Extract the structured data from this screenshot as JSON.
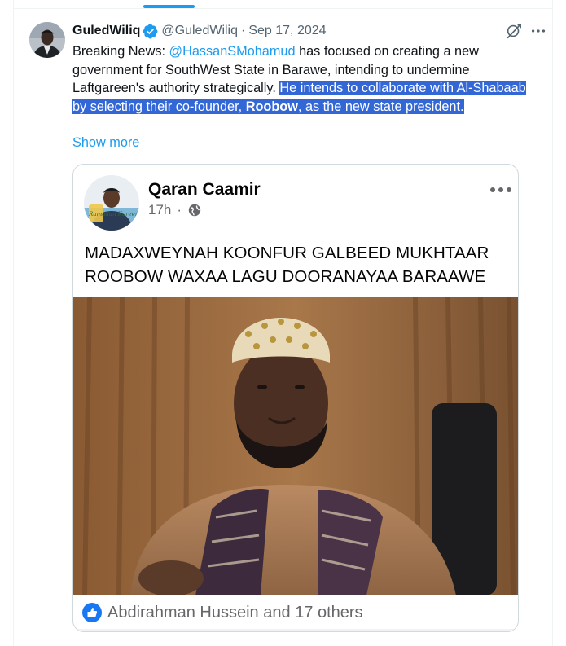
{
  "tweet": {
    "author_name": "GuledWiliq",
    "author_handle": "@GuledWiliq",
    "separator": "·",
    "date": "Sep 17, 2024",
    "text_before_mention": "Breaking News: ",
    "mention": "@HassanSMohamud",
    "text_after_mention": " has focused on creating a new government for SouthWest State in Barawe, intending to undermine Laftgareen's authority strategically. ",
    "highlighted_text": "He intends to collaborate with Al-Shabaab by selecting their co-founder, ",
    "highlighted_bold": "Roobow",
    "highlighted_tail": ", as the new state president.",
    "show_more_label": "Show more"
  },
  "embedded_post": {
    "page_name": "Qaran Caamir",
    "time_ago": "17h",
    "dot": "·",
    "headline": "MADAXWEYNAH KOONFUR GALBEED  MUKHTAAR ROOBOW  WAXAA LAGU DOORANAYAA BARAAWE",
    "reactions_text": "Abdirahman Hussein and 17 others",
    "avatar_logo_text": "Ramadan Kareem"
  },
  "icons": {
    "verified": "verified-badge-icon",
    "grok": "grok-icon",
    "more": "more-options-icon",
    "globe": "globe-icon",
    "like": "like-reaction-icon"
  },
  "colors": {
    "link_blue": "#1d9bf0",
    "selection_blue": "#3367d6",
    "text_primary": "#0f1419",
    "text_secondary": "#536471",
    "fb_gray": "#65676b"
  }
}
